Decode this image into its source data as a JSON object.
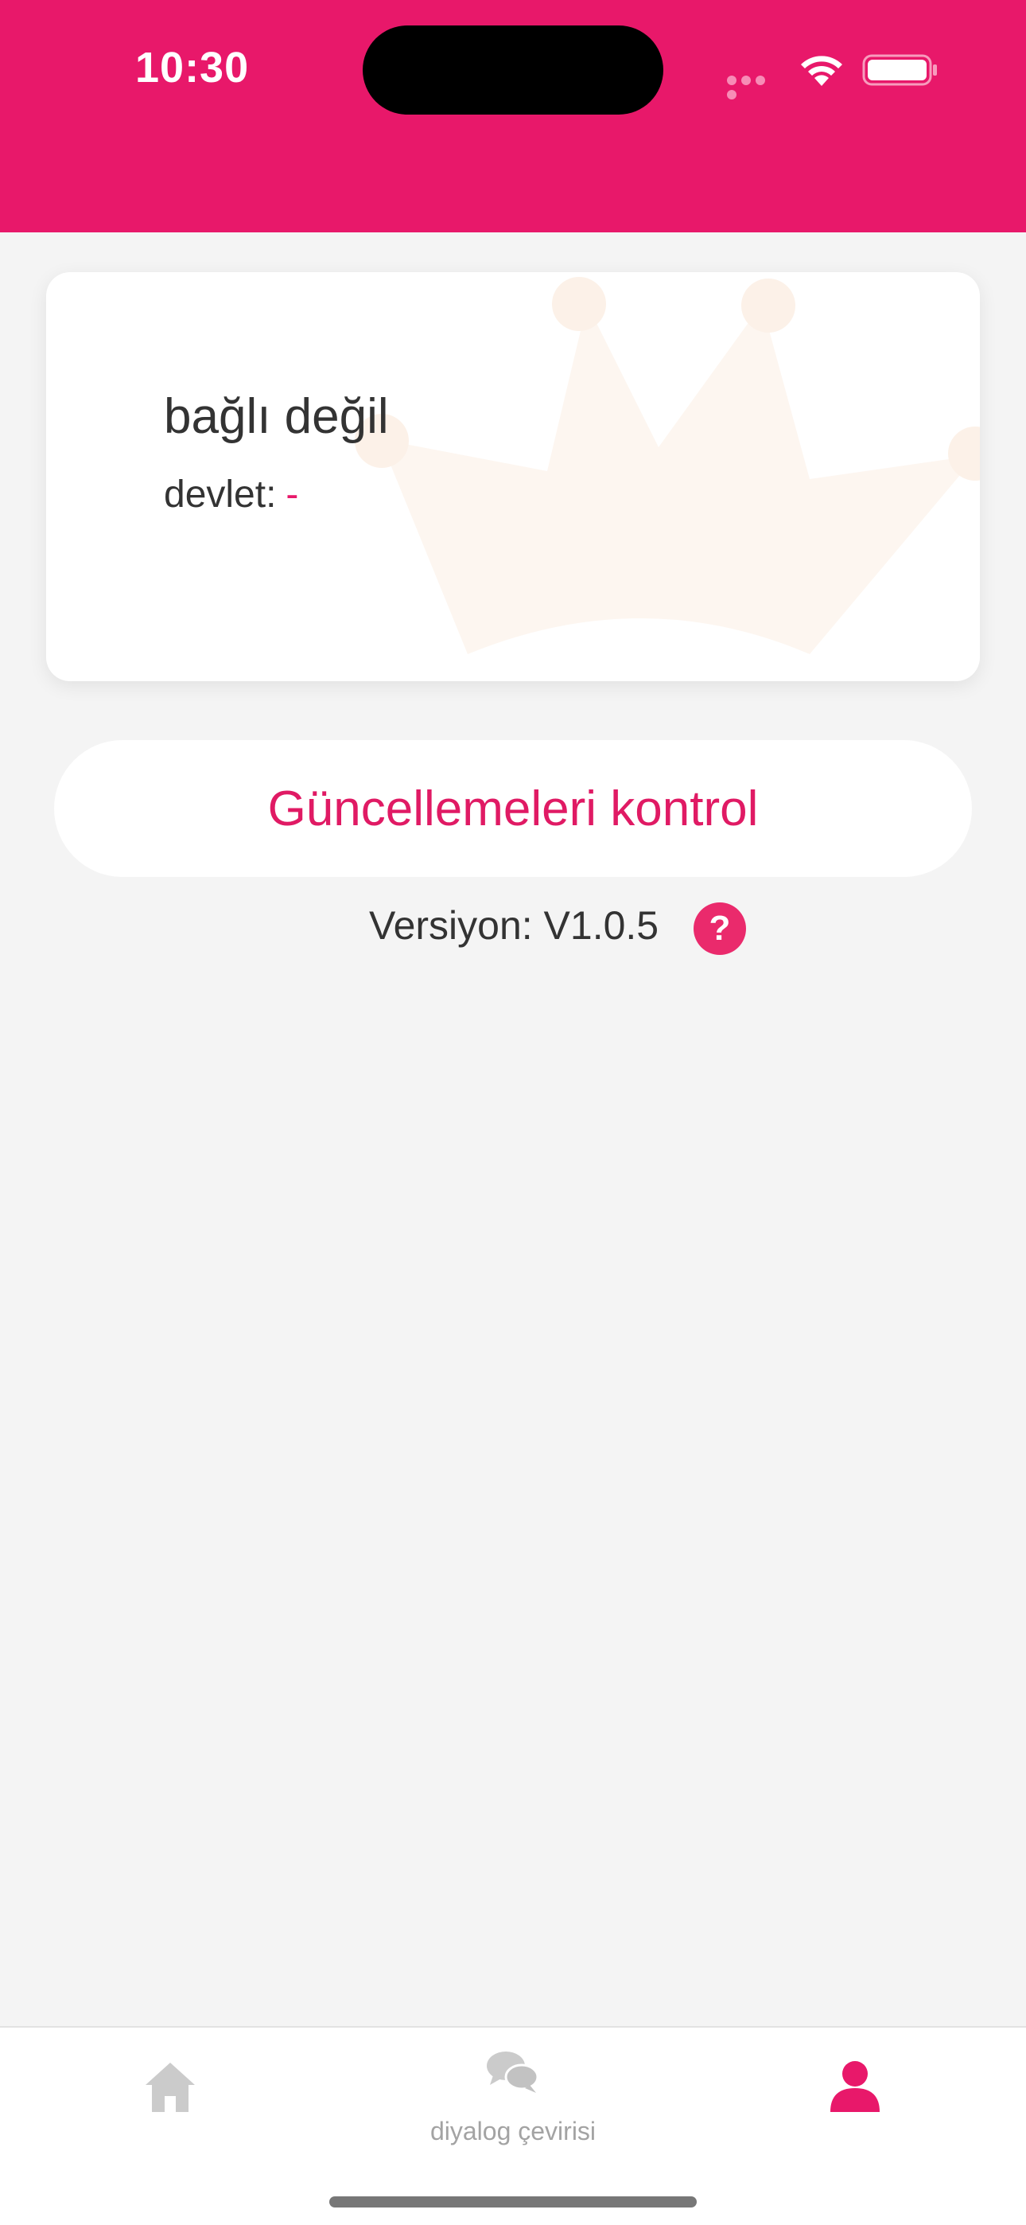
{
  "status_bar": {
    "time": "10:30"
  },
  "card": {
    "title": "bağlı değil",
    "state_label": "devlet:",
    "state_value": "-"
  },
  "update_button": {
    "label": "Güncellemeleri kontrol"
  },
  "version": {
    "text": "Versiyon: V1.0.5",
    "help_icon": "?"
  },
  "tabbar": {
    "items": [
      {
        "icon": "home-icon",
        "label": ""
      },
      {
        "icon": "chat-icon",
        "label": "diyalog çevirisi"
      },
      {
        "icon": "user-icon",
        "label": ""
      }
    ],
    "active_index": 2
  },
  "colors": {
    "accent": "#e8186a",
    "inactive": "#c8c8c8",
    "background": "#f4f4f4"
  }
}
